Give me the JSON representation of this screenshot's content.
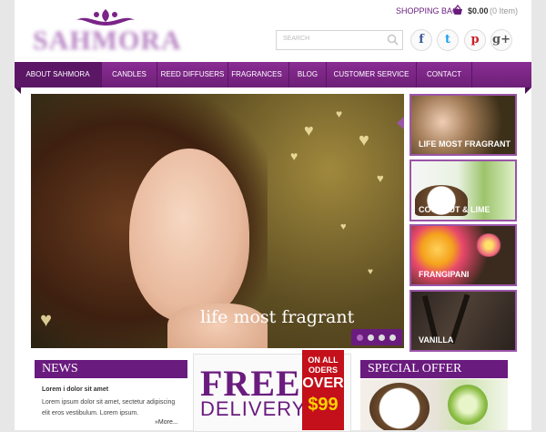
{
  "header": {
    "brand": "SAHMORA",
    "bag_label": "SHOPPING BAG",
    "bag_total": "$0.00",
    "bag_items": "(0 Item)",
    "search_placeholder": "SEARCH",
    "social": [
      {
        "name": "facebook",
        "glyph": "f",
        "color": "#3b5998"
      },
      {
        "name": "twitter",
        "glyph": "t",
        "color": "#1da1f2"
      },
      {
        "name": "pinterest",
        "glyph": "p",
        "color": "#cb2027"
      },
      {
        "name": "google-plus",
        "glyph": "g+",
        "color": "#555555"
      }
    ]
  },
  "nav": {
    "items": [
      {
        "label": "ABOUT SAHMORA"
      },
      {
        "label": "CANDLES"
      },
      {
        "label": "REED DIFFUSERS"
      },
      {
        "label": "FRAGRANCES"
      },
      {
        "label": "BLOG"
      },
      {
        "label": "CUSTOMER SERVICE"
      },
      {
        "label": "CONTACT"
      }
    ]
  },
  "hero": {
    "caption": "life most fragrant",
    "active_slide": 1,
    "slide_count": 4
  },
  "thumbs": [
    {
      "label": "LIFE MOST FRAGRANT"
    },
    {
      "label": "COCONUT & LIME"
    },
    {
      "label": "FRANGIPANI"
    },
    {
      "label": "VANILLA"
    }
  ],
  "news": {
    "heading": "NEWS",
    "title": "Lorem i dolor sit amet",
    "body": "Lorem ipsum dolor sit amet, sectetur adipiscing elit eros vestibulum. Lorem ipsum.",
    "more": "»More..."
  },
  "delivery": {
    "free": "FREE",
    "delivery": "DELIVERY",
    "ribbon_top": "ON ALL ODERS",
    "ribbon_over": "OVER",
    "ribbon_amount": "$99"
  },
  "special": {
    "heading": "SPECIAL OFFER"
  },
  "colors": {
    "brand_purple": "#6a1b7e",
    "ribbon_red": "#c3101a",
    "ribbon_gold": "#ffd200"
  }
}
